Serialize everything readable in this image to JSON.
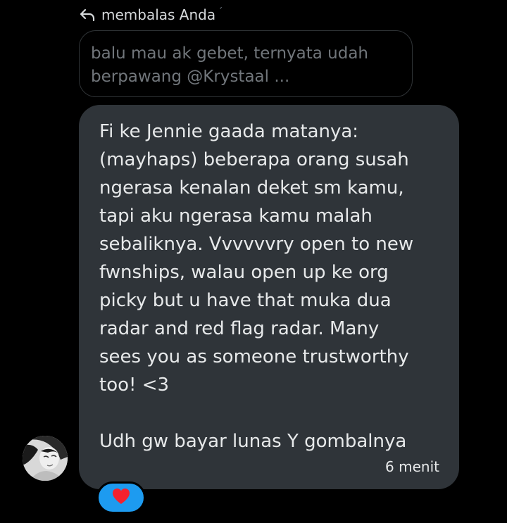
{
  "reply_header": {
    "icon": "reply-arrow-icon",
    "label": "membalas Anda",
    "suffix": "´"
  },
  "quoted_message": {
    "text": "balu mau ak gebet, ternyata udah\nberpawang @Krystaal ..."
  },
  "message": {
    "text": "Fi ke Jennie gaada matanya:\n(mayhaps) beberapa orang susah\nngerasa kenalan deket sm kamu,\ntapi aku ngerasa kamu malah\nsebaliknya. Vvvvvvry open to new\nfwnships, walau open up ke org\npicky but u have that muka dua\nradar and red flag radar. Many\nsees you as someone trustworthy\ntoo! <3\n\nUdh gw bayar lunas Y gombalnya",
    "time": "6 menit",
    "bubble_color": "#2f3439"
  },
  "sender": {
    "avatar": "user-avatar"
  },
  "reaction": {
    "icon": "heart-icon",
    "pill_color": "#1d9bf0",
    "heart_color": "#f4212e"
  },
  "colors": {
    "background": "#000000",
    "text_primary": "#e7e9ea",
    "text_muted": "#71767b",
    "accent": "#1d9bf0"
  }
}
